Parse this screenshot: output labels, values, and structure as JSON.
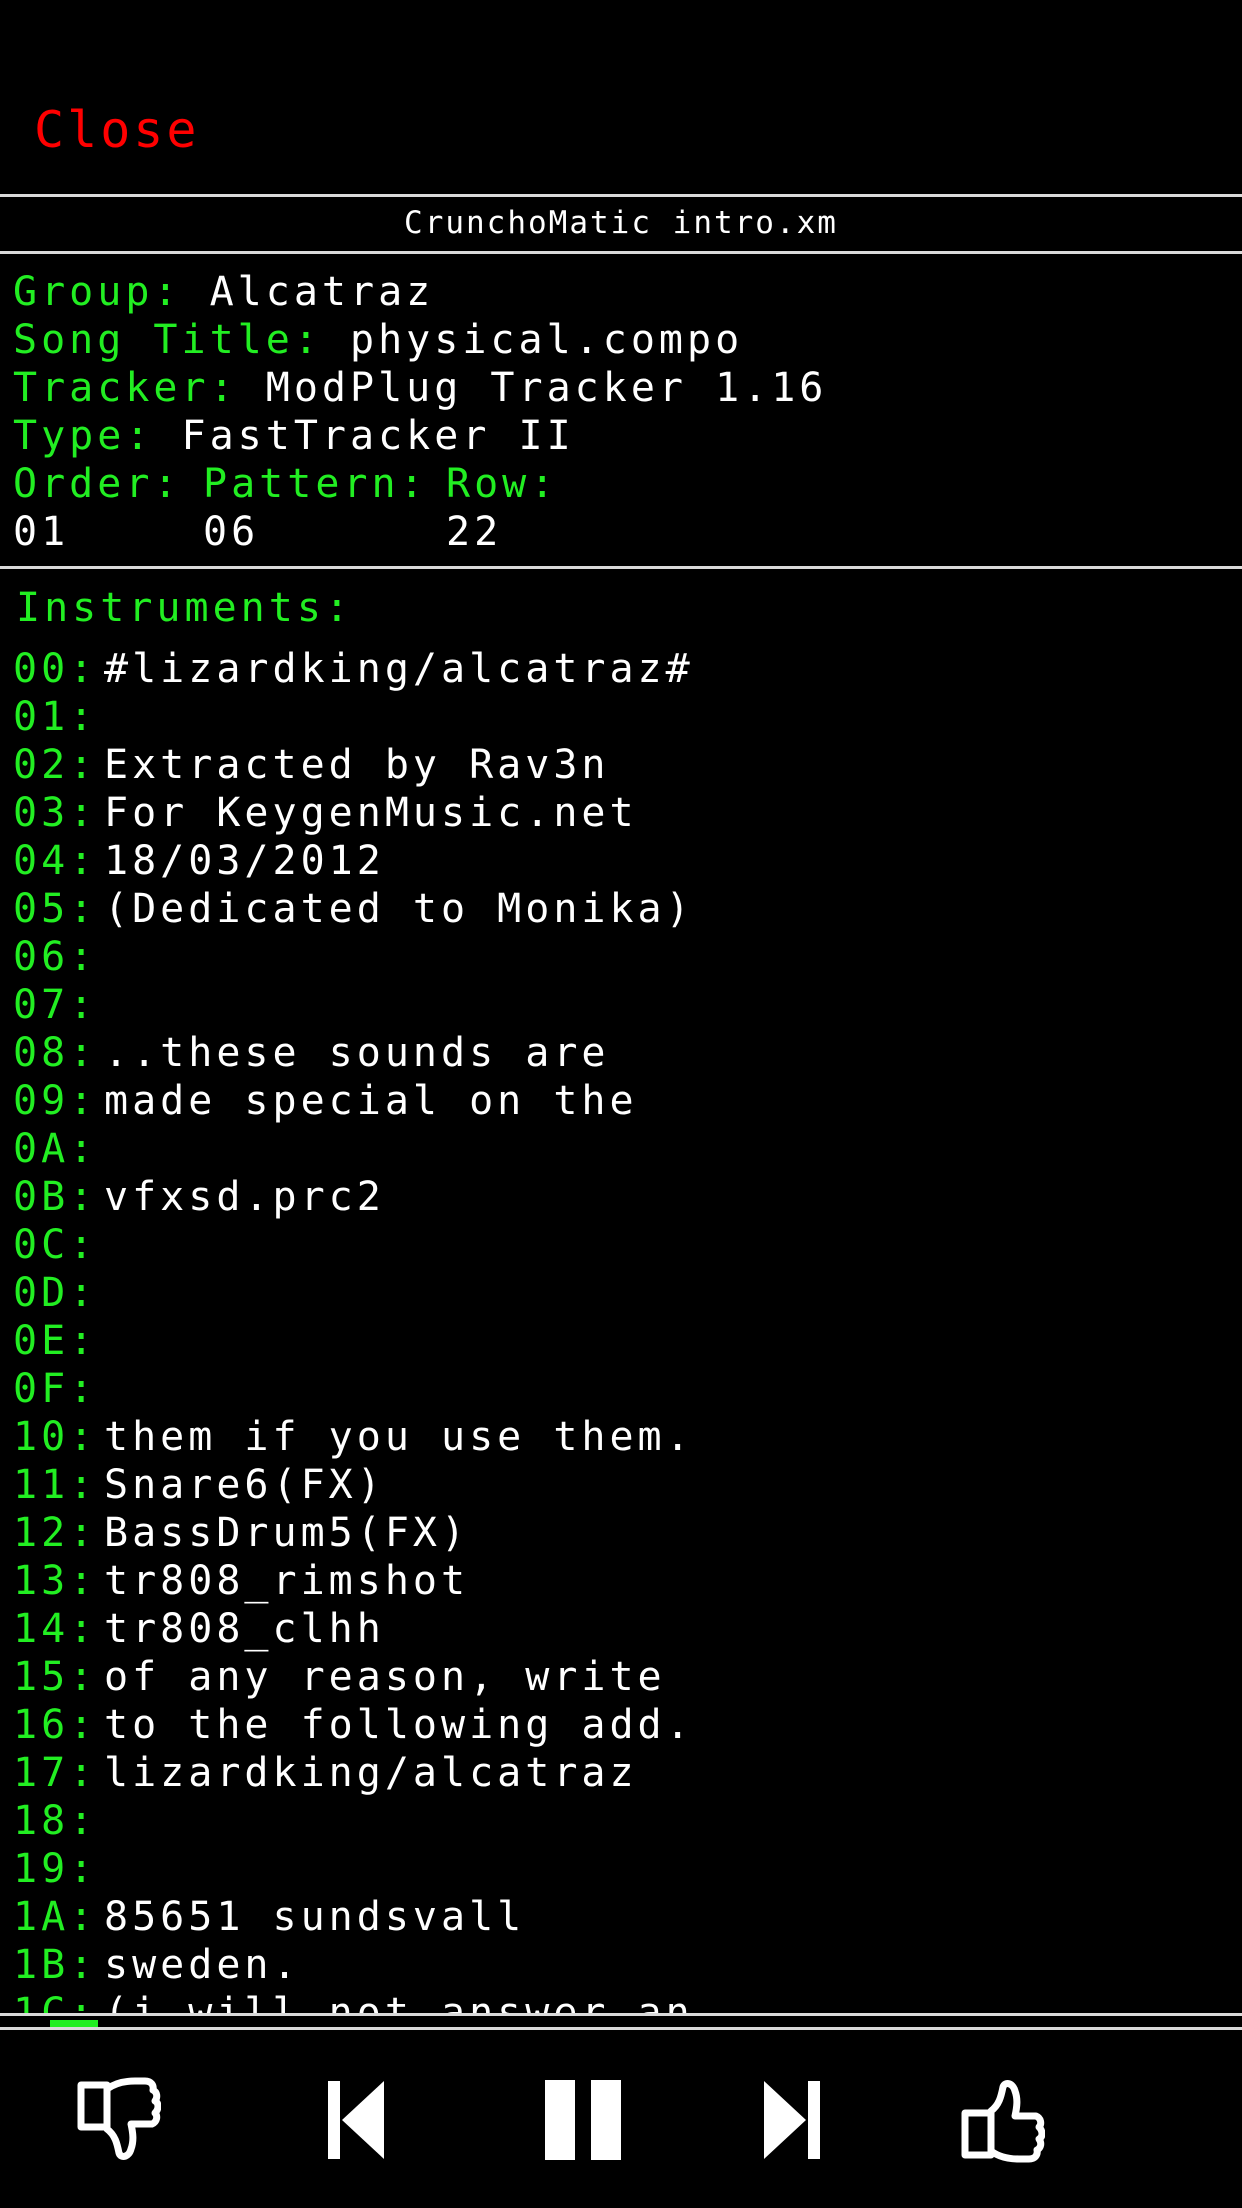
{
  "header": {
    "close_label": "Close",
    "file_title": "CrunchoMatic intro.xm"
  },
  "info": {
    "group_label": "Group:",
    "group_value": "Alcatraz",
    "song_title_label": "Song Title:",
    "song_title_value": "physical.compo",
    "tracker_label": "Tracker:",
    "tracker_value": "ModPlug Tracker 1.16",
    "type_label": "Type:",
    "type_value": "FastTracker II",
    "order_label": "Order:",
    "pattern_label": "Pattern:",
    "row_label": "Row:",
    "order_value": "01",
    "pattern_value": "06",
    "row_value": "22"
  },
  "instruments": {
    "heading": "Instruments:",
    "items": [
      {
        "idx": "00:",
        "name": "#lizardking/alcatraz#"
      },
      {
        "idx": "01:",
        "name": ""
      },
      {
        "idx": "02:",
        "name": "Extracted by Rav3n"
      },
      {
        "idx": "03:",
        "name": "For KeygenMusic.net"
      },
      {
        "idx": "04:",
        "name": "18/03/2012"
      },
      {
        "idx": "05:",
        "name": "(Dedicated to Monika)"
      },
      {
        "idx": "06:",
        "name": ""
      },
      {
        "idx": "07:",
        "name": ""
      },
      {
        "idx": "08:",
        "name": "..these sounds are"
      },
      {
        "idx": "09:",
        "name": "made special on the"
      },
      {
        "idx": "0A:",
        "name": ""
      },
      {
        "idx": "0B:",
        "name": "vfxsd.prc2"
      },
      {
        "idx": "0C:",
        "name": ""
      },
      {
        "idx": "0D:",
        "name": ""
      },
      {
        "idx": "0E:",
        "name": ""
      },
      {
        "idx": "0F:",
        "name": ""
      },
      {
        "idx": "10:",
        "name": "them if you use them."
      },
      {
        "idx": "11:",
        "name": "Snare6(FX)"
      },
      {
        "idx": "12:",
        "name": "BassDrum5(FX)"
      },
      {
        "idx": "13:",
        "name": "tr808_rimshot"
      },
      {
        "idx": "14:",
        "name": "tr808_clhh"
      },
      {
        "idx": "15:",
        "name": "of any reason, write"
      },
      {
        "idx": "16:",
        "name": "to the following add."
      },
      {
        "idx": "17:",
        "name": "lizardking/alcatraz"
      },
      {
        "idx": "18:",
        "name": ""
      },
      {
        "idx": "19:",
        "name": ""
      },
      {
        "idx": "1A:",
        "name": "85651 sundsvall"
      },
      {
        "idx": "1B:",
        "name": "sweden."
      },
      {
        "idx": "1C:",
        "name": "(i will not answer an"
      }
    ]
  },
  "playback": {
    "progress": 0.04
  },
  "controls": {
    "icons": [
      "thumbs-down-icon",
      "previous-track-icon",
      "pause-icon",
      "next-track-icon",
      "thumbs-up-icon"
    ]
  },
  "colors": {
    "background": "#000000",
    "label_green": "#22ee22",
    "value_white": "#ffffff",
    "close_red": "#ff0000",
    "divider": "#d9d9d9"
  }
}
